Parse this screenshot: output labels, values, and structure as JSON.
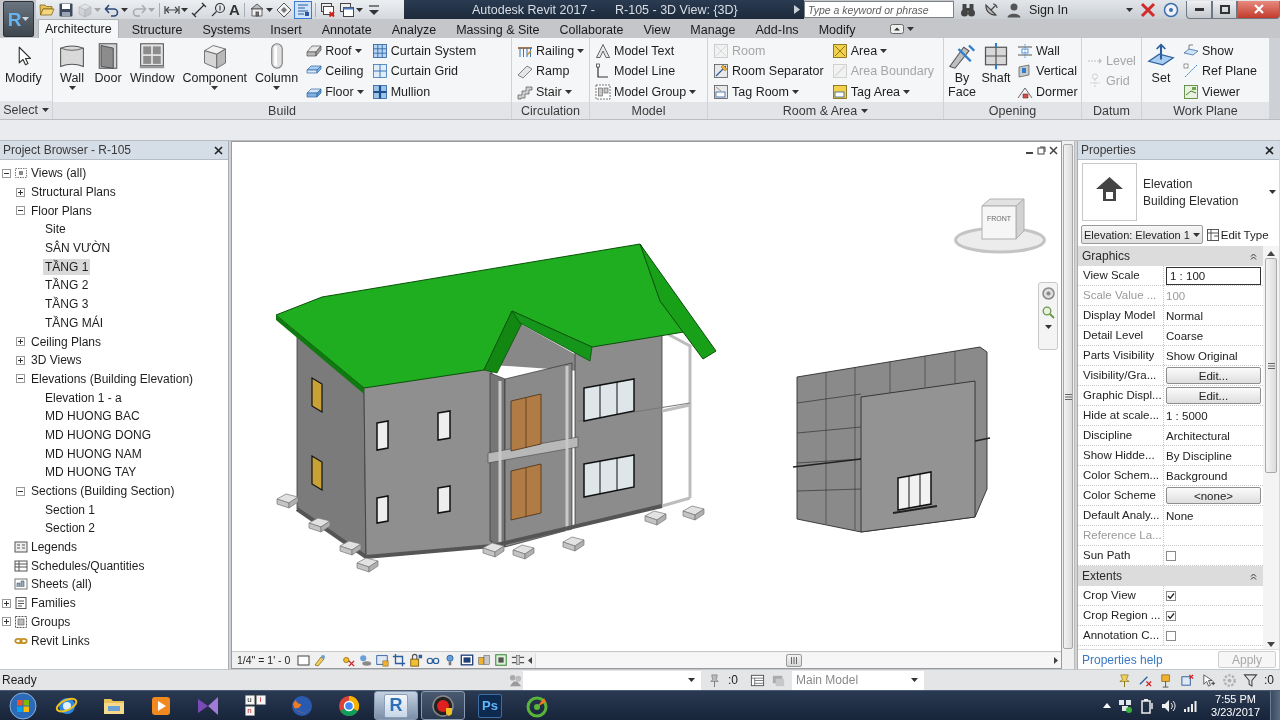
{
  "app_button": {
    "label": "R"
  },
  "quick_access_toolbar": [
    {
      "kind": "open",
      "dropdown": false,
      "disabled": false,
      "on": false
    },
    {
      "kind": "save",
      "dropdown": false,
      "disabled": false,
      "on": false
    },
    {
      "kind": "sync",
      "dropdown": true,
      "disabled": true,
      "on": false
    },
    {
      "kind": "undo",
      "dropdown": true,
      "disabled": false,
      "on": false
    },
    {
      "kind": "redo",
      "dropdown": true,
      "disabled": true,
      "on": false
    },
    {
      "kind": "align",
      "dropdown": true,
      "disabled": false,
      "on": false
    },
    {
      "kind": "measure",
      "dropdown": false,
      "disabled": false,
      "on": false
    },
    {
      "kind": "tag",
      "dropdown": false,
      "disabled": false,
      "on": false
    },
    {
      "kind": "text",
      "label": "A",
      "dropdown": false,
      "disabled": false,
      "on": false
    },
    {
      "kind": "default-3d",
      "dropdown": true,
      "disabled": false,
      "on": false
    },
    {
      "kind": "section",
      "dropdown": false,
      "disabled": false,
      "on": false
    },
    {
      "kind": "thin-lines",
      "dropdown": false,
      "disabled": false,
      "on": true
    },
    {
      "kind": "close-hidden",
      "dropdown": false,
      "disabled": false,
      "on": false
    },
    {
      "kind": "switch-windows",
      "dropdown": true,
      "disabled": false,
      "on": false
    },
    {
      "kind": "customize",
      "dropdown": false,
      "disabled": false,
      "on": false
    }
  ],
  "title_bar": {
    "app_title": "Autodesk Revit 2017 -",
    "document_title": "R-105 - 3D View: {3D}",
    "search": {
      "placeholder": "Type a keyword or phrase"
    },
    "sign_in": "Sign In"
  },
  "ribbon_tabs": [
    {
      "label": "Architecture",
      "selected": true
    },
    {
      "label": "Structure",
      "selected": false
    },
    {
      "label": "Systems",
      "selected": false
    },
    {
      "label": "Insert",
      "selected": false
    },
    {
      "label": "Annotate",
      "selected": false
    },
    {
      "label": "Analyze",
      "selected": false
    },
    {
      "label": "Massing & Site",
      "selected": false
    },
    {
      "label": "Collaborate",
      "selected": false
    },
    {
      "label": "View",
      "selected": false
    },
    {
      "label": "Manage",
      "selected": false
    },
    {
      "label": "Add-Ins",
      "selected": false
    },
    {
      "label": "Modify",
      "selected": false
    }
  ],
  "ribbon_panels": [
    {
      "title": "Select",
      "menu": true,
      "columns": [
        {
          "kind": "large",
          "label": "Modify",
          "dropdown": false,
          "disabled": false
        }
      ]
    },
    {
      "title": "Build",
      "menu": false,
      "columns": [
        {
          "kind": "large",
          "label": "Wall",
          "dropdown": true,
          "disabled": false
        },
        {
          "kind": "large",
          "label": "Door",
          "dropdown": false,
          "disabled": false
        },
        {
          "kind": "large",
          "label": "Window",
          "dropdown": false,
          "disabled": false
        },
        {
          "kind": "large",
          "label": "Component",
          "dropdown": true,
          "disabled": false
        },
        {
          "kind": "large",
          "label": "Column",
          "dropdown": true,
          "disabled": false
        },
        {
          "kind": "stack",
          "items": [
            {
              "label": "Roof",
              "dropdown": true,
              "disabled": false
            },
            {
              "label": "Ceiling",
              "dropdown": false,
              "disabled": false
            },
            {
              "label": "Floor",
              "dropdown": true,
              "disabled": false
            }
          ]
        },
        {
          "kind": "stack",
          "items": [
            {
              "label": "Curtain System",
              "dropdown": false,
              "disabled": false
            },
            {
              "label": "Curtain Grid",
              "dropdown": false,
              "disabled": false
            },
            {
              "label": "Mullion",
              "dropdown": false,
              "disabled": false
            }
          ]
        }
      ]
    },
    {
      "title": "Circulation",
      "menu": false,
      "columns": [
        {
          "kind": "stack",
          "items": [
            {
              "label": "Railing",
              "dropdown": true,
              "disabled": false
            },
            {
              "label": "Ramp",
              "dropdown": false,
              "disabled": false
            },
            {
              "label": "Stair",
              "dropdown": true,
              "disabled": false
            }
          ]
        }
      ]
    },
    {
      "title": "Model",
      "menu": false,
      "columns": [
        {
          "kind": "stack",
          "items": [
            {
              "label": "Model Text",
              "dropdown": false,
              "disabled": false
            },
            {
              "label": "Model Line",
              "dropdown": false,
              "disabled": false
            },
            {
              "label": "Model Group",
              "dropdown": true,
              "disabled": false
            }
          ]
        }
      ]
    },
    {
      "title": "Room & Area",
      "menu": true,
      "columns": [
        {
          "kind": "stack",
          "items": [
            {
              "label": "Room",
              "dropdown": false,
              "disabled": true
            },
            {
              "label": "Room Separator",
              "dropdown": false,
              "disabled": false
            },
            {
              "label": "Tag Room",
              "dropdown": true,
              "disabled": false
            }
          ]
        },
        {
          "kind": "stack",
          "items": [
            {
              "label": "Area",
              "dropdown": true,
              "disabled": false
            },
            {
              "label": "Area Boundary",
              "dropdown": false,
              "disabled": true
            },
            {
              "label": "Tag Area",
              "dropdown": true,
              "disabled": false
            }
          ]
        }
      ]
    },
    {
      "title": "Opening",
      "menu": false,
      "columns": [
        {
          "kind": "large",
          "label": "By Face",
          "dropdown": false,
          "disabled": false
        },
        {
          "kind": "large",
          "label": "Shaft",
          "dropdown": false,
          "disabled": false
        },
        {
          "kind": "stack",
          "items": [
            {
              "label": "Wall",
              "dropdown": false,
              "disabled": false
            },
            {
              "label": "Vertical",
              "dropdown": false,
              "disabled": false
            },
            {
              "label": "Dormer",
              "dropdown": false,
              "disabled": false
            }
          ]
        }
      ]
    },
    {
      "title": "Datum",
      "menu": false,
      "columns": [
        {
          "kind": "stack",
          "items": [
            {
              "label": "Level",
              "dropdown": false,
              "disabled": true
            },
            {
              "label": "Grid",
              "dropdown": false,
              "disabled": true
            }
          ]
        }
      ]
    },
    {
      "title": "Work Plane",
      "menu": false,
      "columns": [
        {
          "kind": "large",
          "label": "Set",
          "dropdown": false,
          "disabled": false
        },
        {
          "kind": "stack",
          "items": [
            {
              "label": "Show",
              "dropdown": false,
              "disabled": false
            },
            {
              "label": "Ref Plane",
              "dropdown": false,
              "disabled": false
            },
            {
              "label": "Viewer",
              "dropdown": false,
              "disabled": false
            }
          ]
        }
      ]
    }
  ],
  "project_browser": {
    "title": "Project Browser - R-105",
    "tree": [
      {
        "label": "Views (all)",
        "kind": "views",
        "expanded": true,
        "selected": false,
        "children": [
          {
            "label": "Structural Plans",
            "expanded": false,
            "selected": false
          },
          {
            "label": "Floor Plans",
            "expanded": true,
            "selected": false,
            "children": [
              {
                "label": "Site",
                "selected": false
              },
              {
                "label": "SÂN VƯỜN",
                "selected": false
              },
              {
                "label": "TẦNG 1",
                "selected": true
              },
              {
                "label": "TẦNG 2",
                "selected": false
              },
              {
                "label": "TẦNG 3",
                "selected": false
              },
              {
                "label": "TẦNG MÁI",
                "selected": false
              }
            ]
          },
          {
            "label": "Ceiling Plans",
            "expanded": false,
            "selected": false
          },
          {
            "label": "3D Views",
            "expanded": false,
            "selected": false
          },
          {
            "label": "Elevations (Building Elevation)",
            "expanded": true,
            "selected": false,
            "children": [
              {
                "label": "Elevation 1 - a",
                "selected": false
              },
              {
                "label": "MD HUONG BAC",
                "selected": false
              },
              {
                "label": "MD HUONG DONG",
                "selected": false
              },
              {
                "label": "MD HUONG NAM",
                "selected": false
              },
              {
                "label": "MD HUONG TAY",
                "selected": false
              }
            ]
          },
          {
            "label": "Sections (Building Section)",
            "expanded": true,
            "selected": false,
            "children": [
              {
                "label": "Section 1",
                "selected": false
              },
              {
                "label": "Section 2",
                "selected": false
              }
            ]
          }
        ]
      },
      {
        "label": "Legends",
        "kind": "legends",
        "selected": false
      },
      {
        "label": "Schedules/Quantities",
        "kind": "schedules",
        "selected": false
      },
      {
        "label": "Sheets (all)",
        "kind": "sheets",
        "selected": false
      },
      {
        "label": "Families",
        "kind": "families",
        "expanded": false,
        "selected": false
      },
      {
        "label": "Groups",
        "kind": "groups",
        "expanded": false,
        "selected": false
      },
      {
        "label": "Revit Links",
        "kind": "links",
        "selected": false
      }
    ]
  },
  "view": {
    "view_cube": {
      "label": "FRONT"
    },
    "scale": "1/4\" = 1' - 0"
  },
  "properties": {
    "title": "Properties",
    "type": {
      "category": "Elevation",
      "family": "Building Elevation"
    },
    "instance_selector": "Elevation: Elevation 1",
    "edit_type": "Edit Type",
    "groups": [
      {
        "title": "Graphics",
        "expanded": true,
        "rows": [
          {
            "label": "View Scale",
            "kind": "input",
            "value": "1 : 100",
            "disabled": false
          },
          {
            "label": "Scale Value ...",
            "kind": "text",
            "value": "100",
            "disabled": true
          },
          {
            "label": "Display Model",
            "kind": "text",
            "value": "Normal",
            "disabled": false
          },
          {
            "label": "Detail Level",
            "kind": "text",
            "value": "Coarse",
            "disabled": false
          },
          {
            "label": "Parts Visibility",
            "kind": "text",
            "value": "Show Original",
            "disabled": false
          },
          {
            "label": "Visibility/Gra...",
            "kind": "button",
            "value": "Edit...",
            "disabled": false
          },
          {
            "label": "Graphic Displ...",
            "kind": "button",
            "value": "Edit...",
            "disabled": false
          },
          {
            "label": "Hide at scale...",
            "kind": "text",
            "value": "1 : 5000",
            "disabled": false
          },
          {
            "label": "Discipline",
            "kind": "text",
            "value": "Architectural",
            "disabled": false
          },
          {
            "label": "Show Hidde...",
            "kind": "text",
            "value": "By Discipline",
            "disabled": false
          },
          {
            "label": "Color Schem...",
            "kind": "text",
            "value": "Background",
            "disabled": false
          },
          {
            "label": "Color Scheme",
            "kind": "button",
            "value": "<none>",
            "disabled": false
          },
          {
            "label": "Default Analy...",
            "kind": "text",
            "value": "None",
            "disabled": false
          },
          {
            "label": "Reference La...",
            "kind": "empty",
            "disabled": true
          },
          {
            "label": "Sun Path",
            "kind": "checkbox",
            "checked": false,
            "disabled": false
          }
        ]
      },
      {
        "title": "Extents",
        "expanded": true,
        "rows": [
          {
            "label": "Crop View",
            "kind": "checkbox",
            "checked": true,
            "disabled": false
          },
          {
            "label": "Crop Region ...",
            "kind": "checkbox",
            "checked": true,
            "disabled": false
          },
          {
            "label": "Annotation C...",
            "kind": "checkbox",
            "checked": false,
            "disabled": false
          }
        ]
      }
    ],
    "help_link": "Properties help",
    "apply": {
      "label": "Apply",
      "disabled": true
    }
  },
  "status_bar": {
    "message": "Ready",
    "count": ":0",
    "design_option": "Main Model",
    "filter_count": ":0"
  },
  "taskbar": {
    "apps": [
      {
        "kind": "e-globe",
        "running": false,
        "selected": false
      },
      {
        "kind": "folder",
        "running": false,
        "selected": false
      },
      {
        "kind": "player",
        "running": false,
        "selected": false
      },
      {
        "kind": "bowtie",
        "running": false,
        "selected": false
      },
      {
        "kind": "keys",
        "labels": [
          "u",
          "i",
          "n"
        ],
        "running": false,
        "selected": false
      },
      {
        "kind": "fox-globe",
        "running": false,
        "selected": false
      },
      {
        "kind": "wheel",
        "running": false,
        "selected": false
      },
      {
        "kind": "r-tile",
        "label": "R",
        "running": true,
        "selected": true
      },
      {
        "kind": "record",
        "running": true,
        "selected": false
      },
      {
        "kind": "ps-tile",
        "label": "Ps",
        "running": false,
        "selected": false
      },
      {
        "kind": "leaf",
        "running": false,
        "selected": false
      }
    ],
    "clock": {
      "time": "7:55 PM",
      "date": "3/23/2017"
    }
  }
}
